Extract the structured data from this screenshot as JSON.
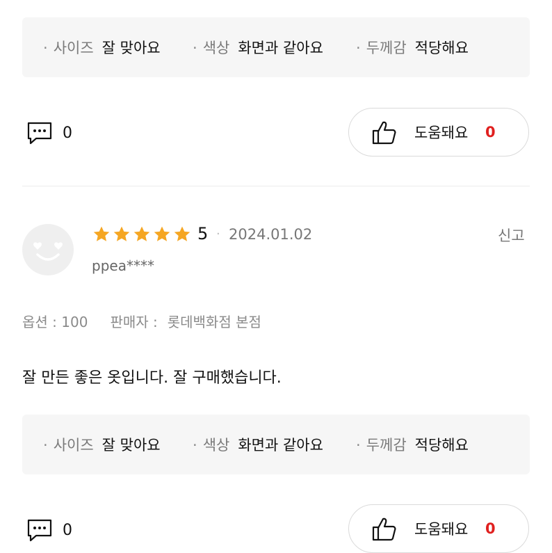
{
  "top_review": {
    "attributes": [
      {
        "label": "사이즈",
        "value": "잘 맞아요"
      },
      {
        "label": "색상",
        "value": "화면과 같아요"
      },
      {
        "label": "두께감",
        "value": "적당해요"
      }
    ],
    "comment_count": "0",
    "helpful_label": "도움돼요",
    "helpful_count": "0"
  },
  "review": {
    "rating": "5",
    "star_count": 5,
    "date": "2024.01.02",
    "report_label": "신고",
    "username": "ppea****",
    "option_label": "옵션 : 100",
    "seller_label": "판매자 :",
    "seller_name": "롯데백화점 본점",
    "text": "잘 만든 좋은 옷입니다. 잘 구매했습니다.",
    "attributes": [
      {
        "label": "사이즈",
        "value": "잘 맞아요"
      },
      {
        "label": "색상",
        "value": "화면과 같아요"
      },
      {
        "label": "두께감",
        "value": "적당해요"
      }
    ],
    "comment_count": "0",
    "helpful_label": "도움돼요",
    "helpful_count": "0"
  },
  "colors": {
    "star": "#f5a623",
    "helpful_count": "#e0201f",
    "attr_box_bg": "#f6f6f6"
  },
  "icons": [
    "comment-icon",
    "thumbs-up-icon",
    "star-icon",
    "smiley-avatar-icon"
  ]
}
